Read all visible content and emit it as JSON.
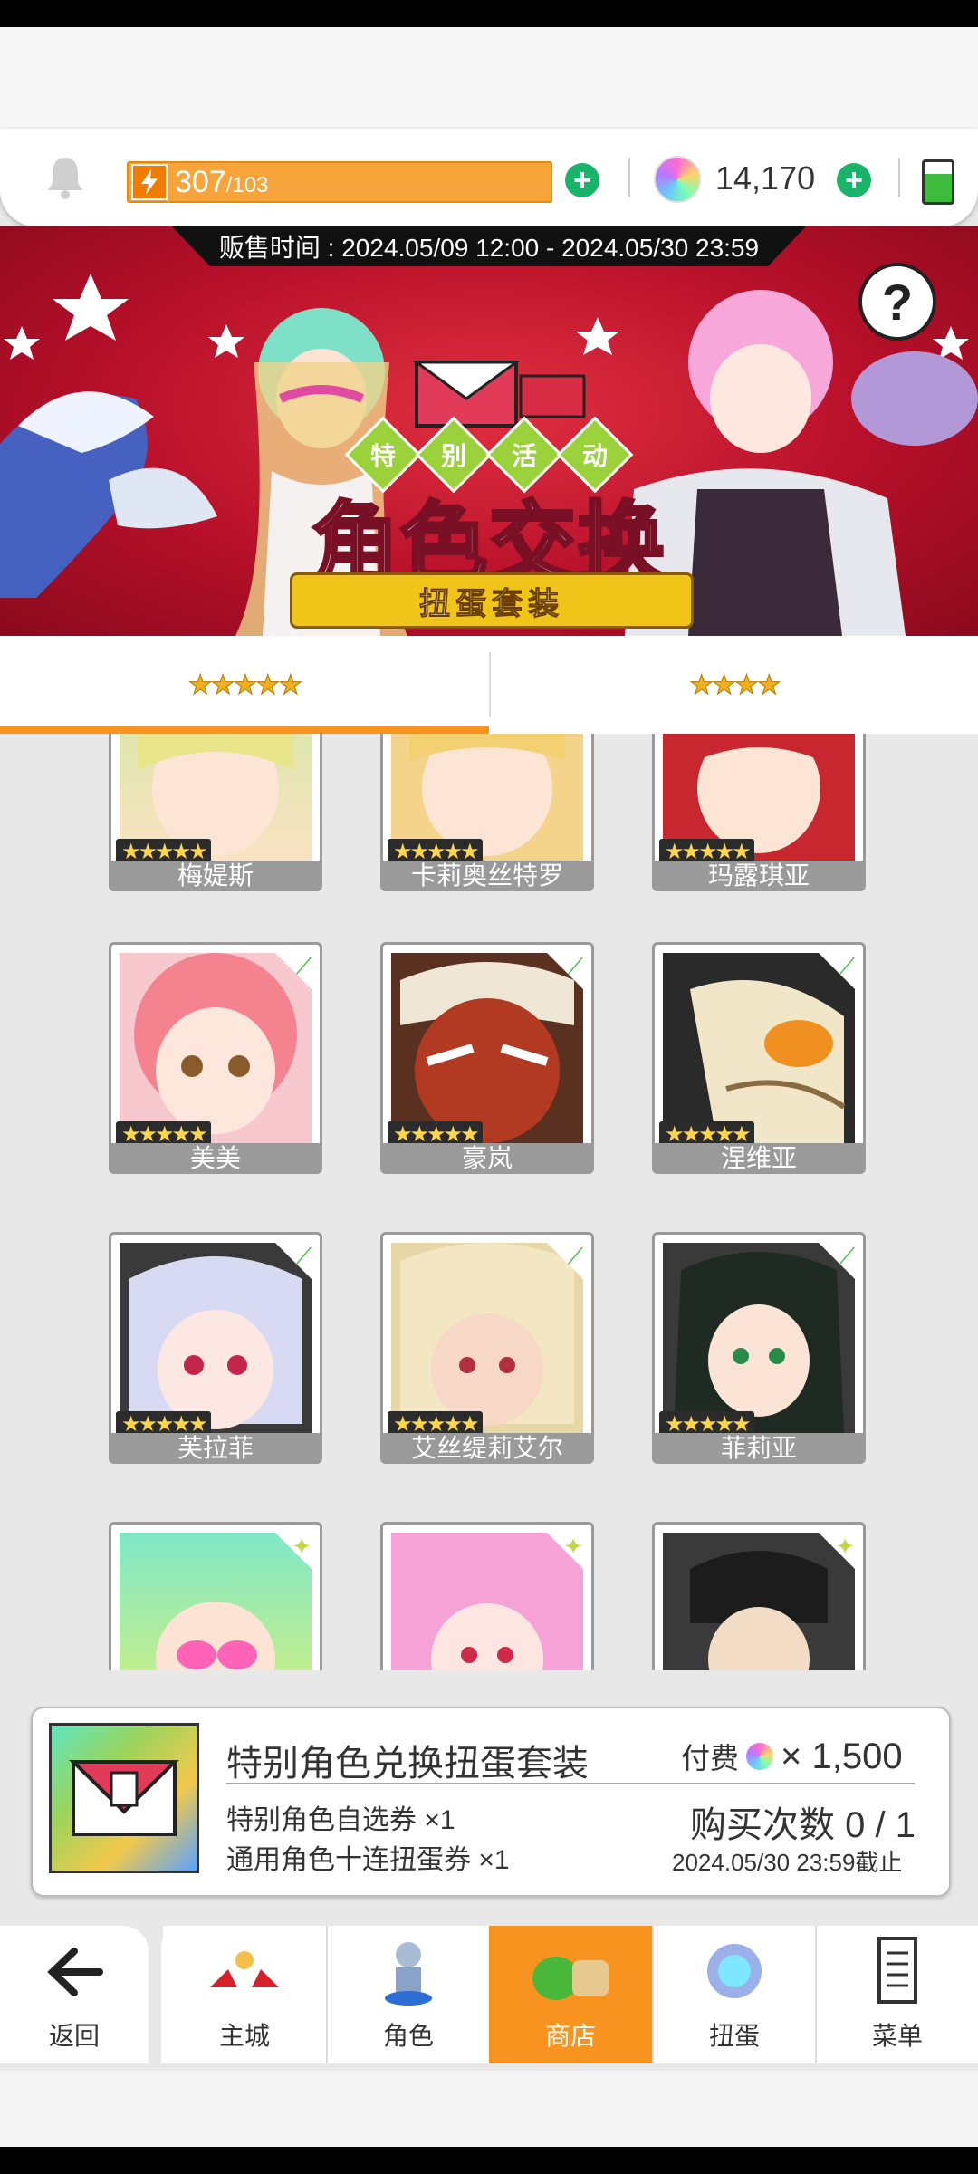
{
  "resources": {
    "stamina_current": "307",
    "stamina_max": "/103",
    "gems": "14,170"
  },
  "banner": {
    "sale_time": "贩售时间 : 2024.05/09 12:00 - 2024.05/30 23:59",
    "event_tag": [
      "特",
      "别",
      "活",
      "动"
    ],
    "title": "角色交换",
    "subtitle": "扭蛋套装",
    "help": "?"
  },
  "tabs": [
    {
      "label": "★★★★★",
      "active": true
    },
    {
      "label": "★★★★",
      "active": false
    }
  ],
  "cards": [
    {
      "name": "梅媞斯",
      "rarity": "★★★★★",
      "badge": ""
    },
    {
      "name": "卡莉奥丝特罗",
      "rarity": "★★★★★",
      "badge": ""
    },
    {
      "name": "玛露琪亚",
      "rarity": "★★★★★",
      "badge": ""
    },
    {
      "name": "美美",
      "rarity": "★★★★★",
      "badge": "green"
    },
    {
      "name": "豪岚",
      "rarity": "★★★★★",
      "badge": "green"
    },
    {
      "name": "涅维亚",
      "rarity": "★★★★★",
      "badge": "green"
    },
    {
      "name": "芙拉菲",
      "rarity": "★★★★★",
      "badge": "green"
    },
    {
      "name": "艾丝缇莉艾尔",
      "rarity": "★★★★★",
      "badge": "green"
    },
    {
      "name": "菲莉亚",
      "rarity": "★★★★★",
      "badge": "green"
    },
    {
      "name": "",
      "rarity": "",
      "badge": "star"
    },
    {
      "name": "",
      "rarity": "",
      "badge": "star"
    },
    {
      "name": "",
      "rarity": "",
      "badge": "star"
    }
  ],
  "purchase": {
    "title": "特别角色兑换扭蛋套装",
    "items": [
      "特别角色自选券 ×1",
      "通用角色十连扭蛋券 ×1"
    ],
    "pay_label": "付费",
    "price": "× 1,500",
    "count": "购买次数 0 / 1",
    "deadline": "2024.05/30 23:59截止"
  },
  "nav": {
    "back": "返回",
    "items": [
      "主城",
      "角色",
      "商店",
      "扭蛋",
      "菜单"
    ],
    "active": "商店"
  },
  "colors": {
    "accent": "#f7931e",
    "stamina": "#f7a43a",
    "plus": "#1ab36a",
    "banner": "#b8102a"
  }
}
